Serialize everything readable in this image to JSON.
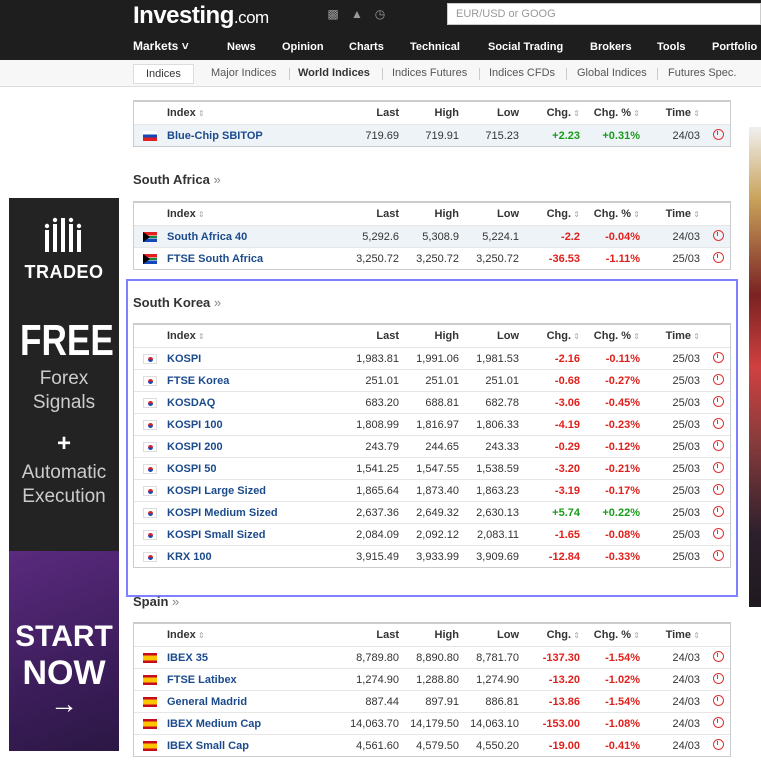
{
  "header": {
    "logo_main": "Investing",
    "logo_suffix": ".com",
    "search_placeholder": "EUR/USD or GOOG",
    "icons": [
      "briefcase-icon",
      "bell-icon",
      "clock-icon"
    ]
  },
  "nav": {
    "markets": "Markets ˅",
    "items": [
      "News",
      "Opinion",
      "Charts",
      "Technical",
      "Social Trading",
      "Brokers",
      "Tools",
      "Portfolio"
    ]
  },
  "subnav": {
    "items": [
      "Indices",
      "Major Indices",
      "World Indices",
      "Indices Futures",
      "Indices CFDs",
      "Global Indices",
      "Futures Spec."
    ]
  },
  "columns": [
    "Index",
    "Last",
    "High",
    "Low",
    "Chg.",
    "Chg. %",
    "Time"
  ],
  "sections": [
    {
      "title": "",
      "rows": [
        {
          "flag": "slovenia",
          "name": "Blue-Chip SBITOP",
          "last": "719.69",
          "high": "719.91",
          "low": "715.23",
          "chg": "+2.23",
          "pct": "+0.31%",
          "time": "24/03",
          "dir": "pos"
        }
      ]
    },
    {
      "title": "South Africa",
      "rows": [
        {
          "flag": "south-africa",
          "name": "South Africa 40",
          "last": "5,292.6",
          "high": "5,308.9",
          "low": "5,224.1",
          "chg": "-2.2",
          "pct": "-0.04%",
          "time": "24/03",
          "dir": "neg"
        },
        {
          "flag": "south-africa",
          "name": "FTSE South Africa",
          "last": "3,250.72",
          "high": "3,250.72",
          "low": "3,250.72",
          "chg": "-36.53",
          "pct": "-1.11%",
          "time": "25/03",
          "dir": "neg"
        }
      ]
    },
    {
      "title": "South Korea",
      "rows": [
        {
          "flag": "south-korea",
          "name": "KOSPI",
          "last": "1,983.81",
          "high": "1,991.06",
          "low": "1,981.53",
          "chg": "-2.16",
          "pct": "-0.11%",
          "time": "25/03",
          "dir": "neg"
        },
        {
          "flag": "south-korea",
          "name": "FTSE Korea",
          "last": "251.01",
          "high": "251.01",
          "low": "251.01",
          "chg": "-0.68",
          "pct": "-0.27%",
          "time": "25/03",
          "dir": "neg"
        },
        {
          "flag": "south-korea",
          "name": "KOSDAQ",
          "last": "683.20",
          "high": "688.81",
          "low": "682.78",
          "chg": "-3.06",
          "pct": "-0.45%",
          "time": "25/03",
          "dir": "neg"
        },
        {
          "flag": "south-korea",
          "name": "KOSPI 100",
          "last": "1,808.99",
          "high": "1,816.97",
          "low": "1,806.33",
          "chg": "-4.19",
          "pct": "-0.23%",
          "time": "25/03",
          "dir": "neg"
        },
        {
          "flag": "south-korea",
          "name": "KOSPI 200",
          "last": "243.79",
          "high": "244.65",
          "low": "243.33",
          "chg": "-0.29",
          "pct": "-0.12%",
          "time": "25/03",
          "dir": "neg"
        },
        {
          "flag": "south-korea",
          "name": "KOSPI 50",
          "last": "1,541.25",
          "high": "1,547.55",
          "low": "1,538.59",
          "chg": "-3.20",
          "pct": "-0.21%",
          "time": "25/03",
          "dir": "neg"
        },
        {
          "flag": "south-korea",
          "name": "KOSPI Large Sized",
          "last": "1,865.64",
          "high": "1,873.40",
          "low": "1,863.23",
          "chg": "-3.19",
          "pct": "-0.17%",
          "time": "25/03",
          "dir": "neg"
        },
        {
          "flag": "south-korea",
          "name": "KOSPI Medium Sized",
          "last": "2,637.36",
          "high": "2,649.32",
          "low": "2,630.13",
          "chg": "+5.74",
          "pct": "+0.22%",
          "time": "25/03",
          "dir": "pos"
        },
        {
          "flag": "south-korea",
          "name": "KOSPI Small Sized",
          "last": "2,084.09",
          "high": "2,092.12",
          "low": "2,083.11",
          "chg": "-1.65",
          "pct": "-0.08%",
          "time": "25/03",
          "dir": "neg"
        },
        {
          "flag": "south-korea",
          "name": "KRX 100",
          "last": "3,915.49",
          "high": "3,933.99",
          "low": "3,909.69",
          "chg": "-12.84",
          "pct": "-0.33%",
          "time": "25/03",
          "dir": "neg"
        }
      ]
    },
    {
      "title": "Spain",
      "rows": [
        {
          "flag": "spain",
          "name": "IBEX 35",
          "last": "8,789.80",
          "high": "8,890.80",
          "low": "8,781.70",
          "chg": "-137.30",
          "pct": "-1.54%",
          "time": "24/03",
          "dir": "neg"
        },
        {
          "flag": "spain",
          "name": "FTSE Latibex",
          "last": "1,274.90",
          "high": "1,288.80",
          "low": "1,274.90",
          "chg": "-13.20",
          "pct": "-1.02%",
          "time": "24/03",
          "dir": "neg"
        },
        {
          "flag": "spain",
          "name": "General Madrid",
          "last": "887.44",
          "high": "897.91",
          "low": "886.81",
          "chg": "-13.86",
          "pct": "-1.54%",
          "time": "24/03",
          "dir": "neg"
        },
        {
          "flag": "spain",
          "name": "IBEX Medium Cap",
          "last": "14,063.70",
          "high": "14,179.50",
          "low": "14,063.10",
          "chg": "-153.00",
          "pct": "-1.08%",
          "time": "24/03",
          "dir": "neg"
        },
        {
          "flag": "spain",
          "name": "IBEX Small Cap",
          "last": "4,561.60",
          "high": "4,579.50",
          "low": "4,550.20",
          "chg": "-19.00",
          "pct": "-0.41%",
          "time": "24/03",
          "dir": "neg"
        }
      ]
    }
  ],
  "ad": {
    "brand": "TRADEO",
    "line1": "FREE",
    "line2": "Forex",
    "line3": "Signals",
    "plus": "+",
    "line4": "Automatic",
    "line5": "Execution",
    "cta1": "START",
    "cta2": "NOW",
    "arrow": "→"
  },
  "colors": {
    "positive": "#1a9b1a",
    "negative": "#e0201b",
    "link": "#1c4b8c",
    "highlight": "#7f80ff"
  }
}
